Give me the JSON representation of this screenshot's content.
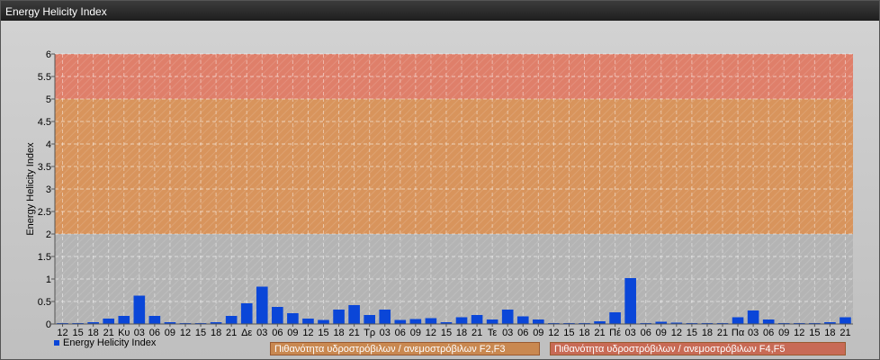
{
  "window": {
    "title": "Energy Helicity Index"
  },
  "legend": {
    "series_label": "Energy Helicity Index",
    "band_f2f3": "Πιθανότητα υδροστρόβιλων / ανεμοστρόβιλων F2,F3",
    "band_f4f5": "Πιθανότητα υδροστρόβιλων / ανεμοστρόβιλων F4,F5"
  },
  "colors": {
    "bar": "#0a46d8",
    "band_low": "#b4b4b4",
    "band_mid": "#d8945c",
    "band_high": "#df7f6a"
  },
  "chart_data": {
    "type": "bar",
    "title": "",
    "xlabel": "",
    "ylabel": "Energy Helicity Index",
    "ylim": [
      0,
      6
    ],
    "yticks": [
      "0",
      "0.5",
      "1",
      "1.5",
      "2",
      "2.5",
      "3",
      "3.5",
      "4",
      "4.5",
      "5",
      "5.5",
      "6"
    ],
    "grid": true,
    "legend_position": "bottom",
    "bands": [
      {
        "from": 0,
        "to": 2,
        "label": ""
      },
      {
        "from": 2,
        "to": 5,
        "label": "Πιθανότητα υδροστρόβιλων / ανεμοστρόβιλων F2,F3"
      },
      {
        "from": 5,
        "to": 6,
        "label": "Πιθανότητα υδροστρόβιλων / ανεμοστρόβιλων F4,F5"
      }
    ],
    "categories": [
      "12",
      "15",
      "18",
      "21",
      "Κυ",
      "03",
      "06",
      "09",
      "12",
      "15",
      "18",
      "21",
      "Δε",
      "03",
      "06",
      "09",
      "12",
      "15",
      "18",
      "21",
      "Τρ",
      "03",
      "06",
      "09",
      "12",
      "15",
      "18",
      "21",
      "Τε",
      "03",
      "06",
      "09",
      "12",
      "15",
      "18",
      "21",
      "Πέ",
      "03",
      "06",
      "09",
      "12",
      "15",
      "18",
      "21",
      "Πα",
      "03",
      "06",
      "09",
      "12",
      "15",
      "18",
      "21"
    ],
    "series": [
      {
        "name": "Energy Helicity Index",
        "values": [
          0.02,
          0.02,
          0.04,
          0.12,
          0.18,
          0.63,
          0.18,
          0.04,
          0.02,
          0.02,
          0.04,
          0.18,
          0.46,
          0.83,
          0.38,
          0.24,
          0.12,
          0.09,
          0.32,
          0.42,
          0.2,
          0.32,
          0.09,
          0.11,
          0.13,
          0.04,
          0.15,
          0.2,
          0.1,
          0.32,
          0.17,
          0.1,
          0.02,
          0.02,
          0.02,
          0.06,
          0.26,
          1.02,
          0.02,
          0.05,
          0.03,
          0.02,
          0.02,
          0.02,
          0.15,
          0.3,
          0.1,
          0.02,
          0.02,
          0.02,
          0.04,
          0.15
        ]
      }
    ]
  }
}
